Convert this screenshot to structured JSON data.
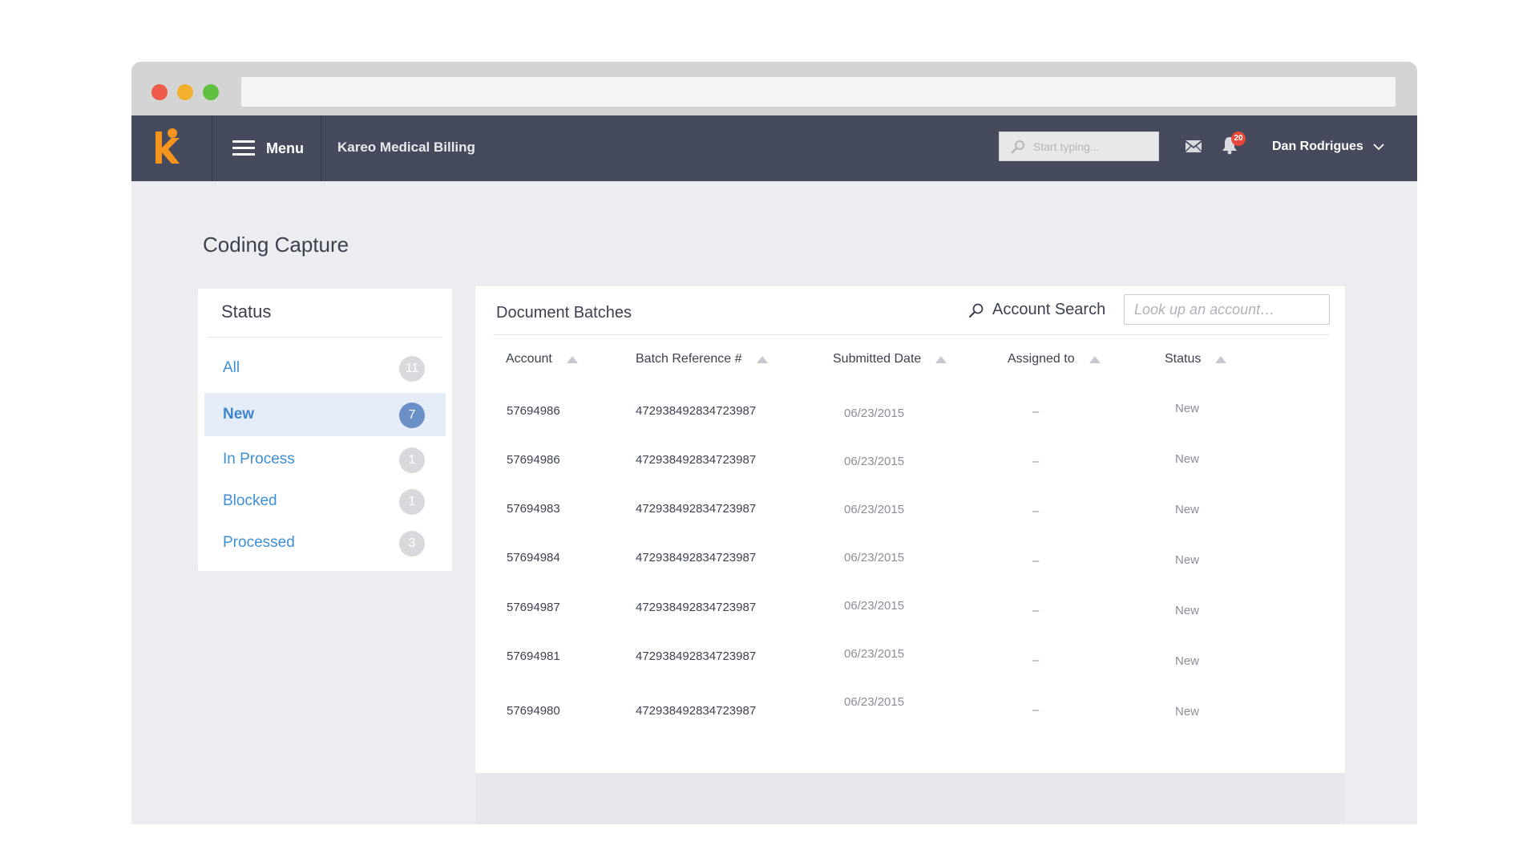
{
  "topnav": {
    "menu_label": "Menu",
    "app_name": "Kareo Medical Billing",
    "search_placeholder": "Start typing...",
    "notification_count": "20",
    "user_name": "Dan Rodrigues",
    "logo_color": "#f7941d"
  },
  "page": {
    "title": "Coding Capture"
  },
  "status_panel": {
    "heading": "Status",
    "items": [
      {
        "label": "All",
        "count": "11"
      },
      {
        "label": "New",
        "count": "7"
      },
      {
        "label": "In Process",
        "count": "1"
      },
      {
        "label": "Blocked",
        "count": "1"
      },
      {
        "label": "Processed",
        "count": "3"
      }
    ]
  },
  "batches": {
    "title": "Document Batches",
    "search_label": "Account Search",
    "search_placeholder": "Look up an account…",
    "columns": [
      "Account",
      "Batch Reference #",
      "Submitted Date",
      "Assigned to",
      "Status"
    ],
    "rows": [
      {
        "account": "57694986",
        "batch_ref": "472938492834723987",
        "date": "06/23/2015",
        "assigned": "–",
        "status": "New"
      },
      {
        "account": "57694986",
        "batch_ref": "472938492834723987",
        "date": "06/23/2015",
        "assigned": "–",
        "status": "New"
      },
      {
        "account": "57694983",
        "batch_ref": "472938492834723987",
        "date": "06/23/2015",
        "assigned": "–",
        "status": "New"
      },
      {
        "account": "57694984",
        "batch_ref": "472938492834723987",
        "date": "06/23/2015",
        "assigned": "–",
        "status": "New"
      },
      {
        "account": "57694987",
        "batch_ref": "472938492834723987",
        "date": "06/23/2015",
        "assigned": "–",
        "status": "New"
      },
      {
        "account": "57694981",
        "batch_ref": "472938492834723987",
        "date": "06/23/2015",
        "assigned": "–",
        "status": "New"
      },
      {
        "account": "57694980",
        "batch_ref": "472938492834723987",
        "date": "06/23/2015",
        "assigned": "–",
        "status": "New"
      }
    ]
  }
}
